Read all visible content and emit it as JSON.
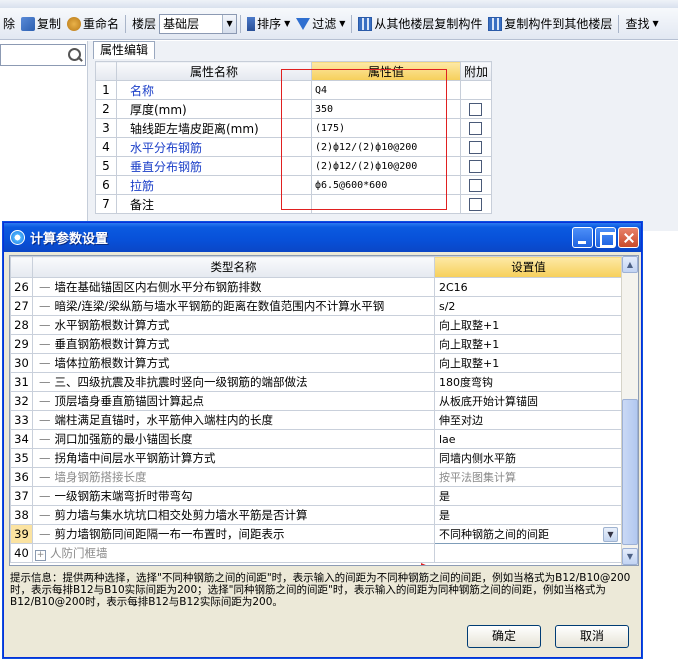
{
  "toolbar": {
    "delete_label": "除",
    "copy_label": "复制",
    "rename_label": "重命名",
    "floor_label": "楼层",
    "floor_value": "基础层",
    "sort_label": "排序",
    "filter_label": "过滤",
    "copy_from_other_label": "从其他楼层复制构件",
    "copy_to_other_label": "复制构件到其他楼层",
    "find_label": "查找"
  },
  "property_panel": {
    "tab_label": "属性编辑",
    "headers": {
      "name": "属性名称",
      "value": "属性值",
      "extra": "附加"
    },
    "rows": [
      {
        "num": "1",
        "name": "名称",
        "value": "Q4",
        "blue": true,
        "has_check": false
      },
      {
        "num": "2",
        "name": "厚度(mm)",
        "value": "350",
        "blue": false,
        "has_check": true
      },
      {
        "num": "3",
        "name": "轴线距左墙皮距离(mm)",
        "value": "(175)",
        "blue": false,
        "has_check": true
      },
      {
        "num": "4",
        "name": "水平分布钢筋",
        "value": "(2)ф12/(2)ф10@200",
        "blue": true,
        "has_check": true
      },
      {
        "num": "5",
        "name": "垂直分布钢筋",
        "value": "(2)ф12/(2)ф10@200",
        "blue": true,
        "has_check": true
      },
      {
        "num": "6",
        "name": "拉筋",
        "value": "ф6.5@600*600",
        "blue": true,
        "has_check": true
      },
      {
        "num": "7",
        "name": "备注",
        "value": "",
        "blue": false,
        "has_check": true
      }
    ]
  },
  "dialog": {
    "title": "计算参数设置",
    "headers": {
      "name": "类型名称",
      "value": "设置值"
    },
    "rows": [
      {
        "num": "26",
        "name": "墙在基础锚固区内右侧水平分布钢筋排数",
        "value": "2C16",
        "gray": false
      },
      {
        "num": "27",
        "name": "暗梁/连梁/梁纵筋与墙水平钢筋的距离在数值范围内不计算水平钢",
        "value": "s/2",
        "gray": false
      },
      {
        "num": "28",
        "name": "水平钢筋根数计算方式",
        "value": "向上取整+1",
        "gray": false
      },
      {
        "num": "29",
        "name": "垂直钢筋根数计算方式",
        "value": "向上取整+1",
        "gray": false
      },
      {
        "num": "30",
        "name": "墙体拉筋根数计算方式",
        "value": "向上取整+1",
        "gray": false
      },
      {
        "num": "31",
        "name": "三、四级抗震及非抗震时竖向一级钢筋的端部做法",
        "value": "180度弯钩",
        "gray": false
      },
      {
        "num": "32",
        "name": "顶层墙身垂直筋锚固计算起点",
        "value": "从板底开始计算锚固",
        "gray": false
      },
      {
        "num": "33",
        "name": "端柱满足直锚时，水平筋伸入端柱内的长度",
        "value": "伸至对边",
        "gray": false
      },
      {
        "num": "34",
        "name": "洞口加强筋的最小锚固长度",
        "value": "lae",
        "gray": false
      },
      {
        "num": "35",
        "name": "拐角墙中间层水平钢筋计算方式",
        "value": "同墙内侧水平筋",
        "gray": false
      },
      {
        "num": "36",
        "name": "墙身钢筋搭接长度",
        "value": "按平法图集计算",
        "gray": true
      },
      {
        "num": "37",
        "name": "一级钢筋末端弯折时带弯勾",
        "value": "是",
        "gray": false
      },
      {
        "num": "38",
        "name": "剪力墙与集水坑坑口相交处剪力墙水平筋是否计算",
        "value": "是",
        "gray": false
      },
      {
        "num": "39",
        "name": "剪力墙钢筋同间距隔一布一布置时，间距表示",
        "value": "不同种钢筋之间的间距",
        "gray": false,
        "selected": true
      }
    ],
    "group_row": {
      "num": "40",
      "name": "人防门框墙",
      "expander": "+"
    },
    "hint": "提示信息：提供两种选择，选择\"不同种钢筋之间的间距\"时，表示输入的间距为不同种钢筋之间的间距，例如当格式为B12/B10@200时，表示每排B12与B10实际间距为200；选择\"同种钢筋之间的间距\"时，表示输入的间距为同种钢筋之间的间距，例如当格式为B12/B10@200时，表示每排B12与B12实际间距为200。",
    "ok_label": "确定",
    "cancel_label": "取消"
  },
  "colors": {
    "accent_red": "#e02020",
    "header_gold": "#f6cf5a",
    "title_blue": "#0850d8",
    "link_blue": "#1a3ec8"
  }
}
